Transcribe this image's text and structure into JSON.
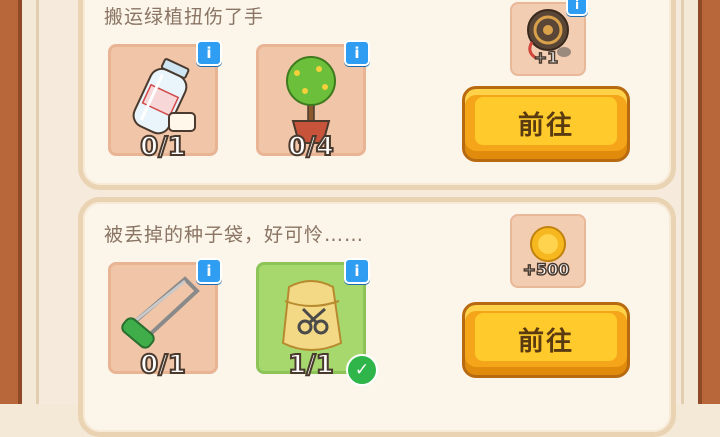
{
  "quests": [
    {
      "description": "搬运绿植扭伤了手",
      "items": [
        {
          "icon": "water-bottle-icon",
          "count": "0/1",
          "done": false
        },
        {
          "icon": "potted-plant-icon",
          "count": "0/4",
          "done": false
        }
      ],
      "reward": {
        "icon": "fan-icon",
        "amount": "+1"
      },
      "button_label": "前往"
    },
    {
      "description": "被丢掉的种子袋，好可怜……",
      "items": [
        {
          "icon": "hacksaw-icon",
          "count": "0/1",
          "done": false
        },
        {
          "icon": "seed-bag-scissors-icon",
          "count": "1/1",
          "done": true
        }
      ],
      "reward": {
        "icon": "coin-icon",
        "amount": "+500"
      },
      "button_label": "前往"
    }
  ],
  "info_label": "i",
  "colors": {
    "frame": "#b8673a",
    "button": "#f4a51a",
    "info": "#2f9df2",
    "done_slot": "#a6d86e",
    "check": "#2fb54a"
  }
}
